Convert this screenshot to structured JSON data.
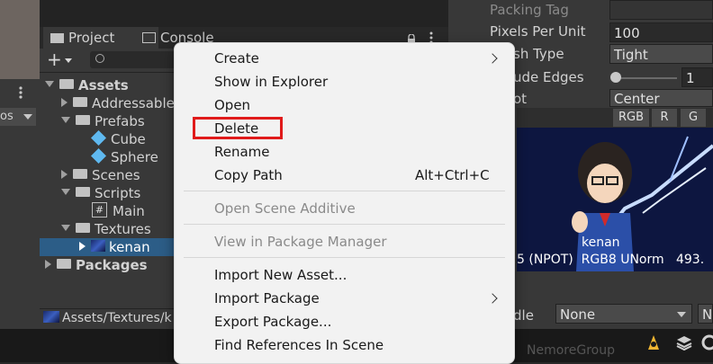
{
  "tabs": {
    "project": "Project",
    "console": "Console"
  },
  "toolbar": {
    "add_label": "+",
    "search_placeholder": ""
  },
  "left_panel": {
    "partial_label": "os"
  },
  "tree": {
    "assets": "Assets",
    "addressables": "Addressable",
    "prefabs": "Prefabs",
    "cube": "Cube",
    "sphere": "Sphere",
    "scenes": "Scenes",
    "scripts": "Scripts",
    "main": "Main",
    "textures": "Textures",
    "kenan": "kenan",
    "packages": "Packages"
  },
  "path_bar": "Assets/Textures/k",
  "inspector": {
    "packing_tag": "Packing Tag",
    "pixels_per_unit": "Pixels Per Unit",
    "pixels_per_unit_value": "100",
    "mesh_type": "sh Type",
    "mesh_type_value": "Tight",
    "extrude_edges": "ude Edges",
    "extrude_value": "1",
    "pivot": "ot",
    "pivot_value": "Center",
    "channel_rgb": "RGB",
    "channel_r": "R",
    "channel_g": "G",
    "preview_name": "kenan",
    "preview_info": "5 (NPOT)  RGB8 UNorm   493.",
    "handle_label": "dle",
    "handle_value": "None",
    "handle_value2": "N"
  },
  "status": {
    "watermark": "NemoreGroup"
  },
  "menu": {
    "create": "Create",
    "show_in_explorer": "Show in Explorer",
    "open": "Open",
    "delete": "Delete",
    "rename": "Rename",
    "copy_path": "Copy Path",
    "copy_path_shortcut": "Alt+Ctrl+C",
    "open_scene_additive": "Open Scene Additive",
    "view_in_package_manager": "View in Package Manager",
    "import_new_asset": "Import New Asset...",
    "import_package": "Import Package",
    "export_package": "Export Package...",
    "find_references": "Find References In Scene"
  },
  "colors": {
    "selection": "#2c5d87",
    "highlight_box": "#e01a1a",
    "menu_bg": "#f2f2f2",
    "panel_bg": "#383838"
  }
}
